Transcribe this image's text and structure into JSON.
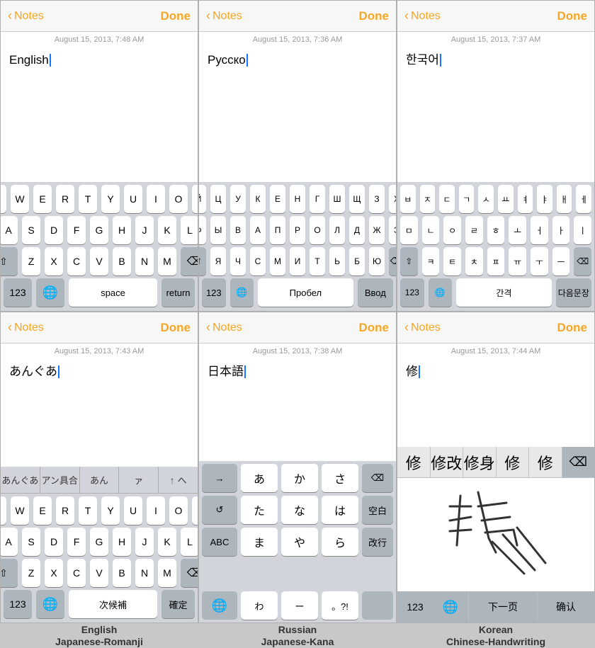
{
  "cells": [
    {
      "id": "english",
      "back_label": "Notes",
      "done_label": "Done",
      "date": "August 15, 2013, 7:48 AM",
      "text": "English",
      "keyboard_type": "qwerty",
      "label": "English"
    },
    {
      "id": "russian",
      "back_label": "Notes",
      "done_label": "Done",
      "date": "August 15, 2013, 7:36 AM",
      "text": "Русско",
      "keyboard_type": "cyrillic",
      "label": "Russian"
    },
    {
      "id": "korean",
      "back_label": "Notes",
      "done_label": "Done",
      "date": "August 15, 2013, 7:37 AM",
      "text": "한국어",
      "keyboard_type": "korean",
      "label": "Korean"
    },
    {
      "id": "japanese-romanji",
      "back_label": "Notes",
      "done_label": "Done",
      "date": "August 15, 2013, 7:43 AM",
      "text": "あんぐあ",
      "keyboard_type": "romanji",
      "label": "Japanese-Romanji"
    },
    {
      "id": "japanese-kana",
      "back_label": "Notes",
      "done_label": "Done",
      "date": "August 15, 2013, 7:38 AM",
      "text": "日本語",
      "keyboard_type": "kana",
      "label": "Japanese-Kana"
    },
    {
      "id": "chinese-handwriting",
      "back_label": "Notes",
      "done_label": "Done",
      "date": "August 15, 2013, 7:44 AM",
      "text": "修",
      "keyboard_type": "handwriting",
      "label": "Chinese-Handwriting"
    }
  ],
  "keyboards": {
    "qwerty": {
      "row1": [
        "Q",
        "W",
        "E",
        "R",
        "T",
        "Y",
        "U",
        "I",
        "O",
        "P"
      ],
      "row2": [
        "A",
        "S",
        "D",
        "F",
        "G",
        "H",
        "J",
        "K",
        "L"
      ],
      "row3": [
        "Z",
        "X",
        "C",
        "V",
        "B",
        "N",
        "M"
      ],
      "bottom": [
        "123",
        "🌐",
        "space",
        "return"
      ]
    },
    "cyrillic": {
      "row1": [
        "Й",
        "Ц",
        "У",
        "К",
        "Е",
        "Н",
        "Г",
        "Ш",
        "Щ",
        "З",
        "Х"
      ],
      "row2": [
        "Ф",
        "Ы",
        "В",
        "А",
        "П",
        "Р",
        "О",
        "Л",
        "Д",
        "Ж",
        "Э"
      ],
      "row3": [
        "Я",
        "Ч",
        "С",
        "М",
        "И",
        "Т",
        "Ь",
        "Б",
        "Ю"
      ],
      "space_label": "Пробел",
      "return_label": "Ввод"
    },
    "korean": {
      "row1": [
        "ㅂ",
        "ㅈ",
        "ㄷ",
        "ㄱ",
        "ㅅ",
        "ㅛ",
        "ㅕ",
        "ㅑ",
        "ㅐ",
        "ㅔ"
      ],
      "row2": [
        "ㅁ",
        "ㄴ",
        "ㅇ",
        "ㄹ",
        "ㅎ",
        "ㅗ",
        "ㅓ",
        "ㅏ",
        "ㅣ"
      ],
      "row3": [
        "ㅋ",
        "ㅌ",
        "ㅊ",
        "ㅍ",
        "ㅠ",
        "ㅜ",
        "ㅡ"
      ],
      "space_label": "간격",
      "return_label": "다음문장"
    },
    "romanji_suggestions": [
      "あんぐあ",
      "アン具合",
      "あん",
      "ァ",
      "へ"
    ],
    "kana": {
      "rows": [
        [
          "→",
          "あ",
          "か",
          "さ",
          "⌫"
        ],
        [
          "↺",
          "た",
          "な",
          "は",
          "空白"
        ],
        [
          "ABC",
          "ま",
          "や",
          "ら",
          "改行"
        ],
        [
          "🌐",
          "わ",
          "ー",
          "。?!",
          ""
        ]
      ]
    },
    "handwriting_suggestions": [
      "修",
      "修改",
      "修身",
      "修",
      "修"
    ],
    "handwriting_bottom": [
      "123",
      "🌐",
      "下一页",
      "确认"
    ]
  }
}
